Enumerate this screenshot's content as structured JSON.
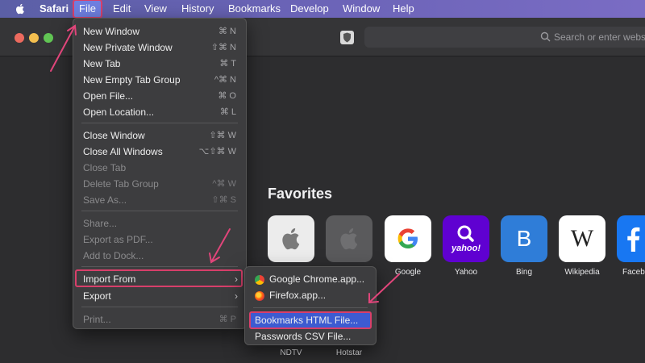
{
  "menubar": {
    "app_name": "Safari",
    "items": [
      "File",
      "Edit",
      "View",
      "History",
      "Bookmarks",
      "Develop",
      "Window",
      "Help"
    ]
  },
  "toolbar": {
    "search_placeholder": "Search or enter webs"
  },
  "file_menu": {
    "items": [
      {
        "label": "New Window",
        "shortcut": "⌘ N",
        "enabled": true
      },
      {
        "label": "New Private Window",
        "shortcut": "⇧⌘ N",
        "enabled": true
      },
      {
        "label": "New Tab",
        "shortcut": "⌘ T",
        "enabled": true
      },
      {
        "label": "New Empty Tab Group",
        "shortcut": "^⌘ N",
        "enabled": true
      },
      {
        "label": "Open File...",
        "shortcut": "⌘ O",
        "enabled": true
      },
      {
        "label": "Open Location...",
        "shortcut": "⌘ L",
        "enabled": true
      },
      {
        "label": "Close Window",
        "shortcut": "⇧⌘ W",
        "enabled": true
      },
      {
        "label": "Close All Windows",
        "shortcut": "⌥⇧⌘ W",
        "enabled": true
      },
      {
        "label": "Close Tab",
        "shortcut": "",
        "enabled": false
      },
      {
        "label": "Delete Tab Group",
        "shortcut": "^⌘ W",
        "enabled": false
      },
      {
        "label": "Save As...",
        "shortcut": "⇧⌘ S",
        "enabled": false
      },
      {
        "label": "Share...",
        "shortcut": "",
        "enabled": false
      },
      {
        "label": "Export as PDF...",
        "shortcut": "",
        "enabled": false
      },
      {
        "label": "Add to Dock...",
        "shortcut": "",
        "enabled": false
      },
      {
        "label": "Import From",
        "shortcut": "",
        "enabled": true,
        "submenu": true
      },
      {
        "label": "Export",
        "shortcut": "",
        "enabled": true,
        "submenu": true
      },
      {
        "label": "Print...",
        "shortcut": "⌘ P",
        "enabled": false
      }
    ]
  },
  "import_submenu": {
    "items": [
      "Google Chrome.app...",
      "Firefox.app...",
      "Bookmarks HTML File...",
      "Passwords CSV File..."
    ]
  },
  "favorites": {
    "title": "Favorites",
    "tiles": [
      "",
      "",
      "Google",
      "Yahoo",
      "Bing",
      "Wikipedia",
      "Faceb"
    ],
    "tile_text": {
      "yahoo": "yahoo!",
      "bing": "B",
      "wiki": "W"
    },
    "second_row": [
      "NDTV",
      "Hotstar"
    ]
  },
  "colors": {
    "highlight": "#d83f6a",
    "selection": "#3d5bd1",
    "menubar_gradient_start": "#5b5fa6"
  }
}
